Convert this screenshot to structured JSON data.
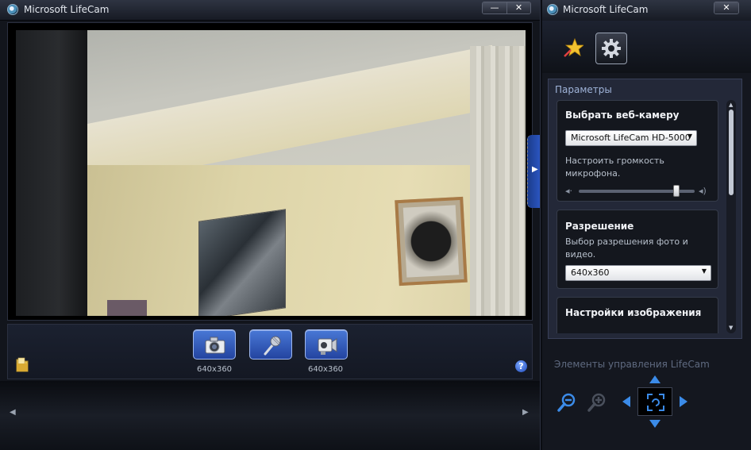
{
  "main": {
    "title": "Microsoft LifeCam",
    "min_label": "—",
    "close_label": "✕",
    "capture": {
      "photo_res": "640x360",
      "video_res": "640x360"
    },
    "help_label": "?",
    "side_tab_label": "▶",
    "strip_left": "◀",
    "strip_right": "▶"
  },
  "panel": {
    "title": "Microsoft LifeCam",
    "close_label": "✕",
    "params_title": "Параметры",
    "webcam": {
      "title": "Выбрать веб-камеру",
      "selected": "Microsoft LifeCam HD-5000",
      "mic_text": "Настроить громкость микрофона.",
      "mic_volume_percent": 86
    },
    "resolution": {
      "title": "Разрешение",
      "text": "Выбор разрешения фото и видео.",
      "selected": "640x360"
    },
    "image_settings": {
      "title": "Настройки изображения"
    },
    "controls_title": "Элементы управления LifeCam"
  },
  "colors": {
    "accent_blue": "#2a55c0",
    "button_blue": "#3a66c8",
    "arrow_blue": "#3b8be8"
  }
}
